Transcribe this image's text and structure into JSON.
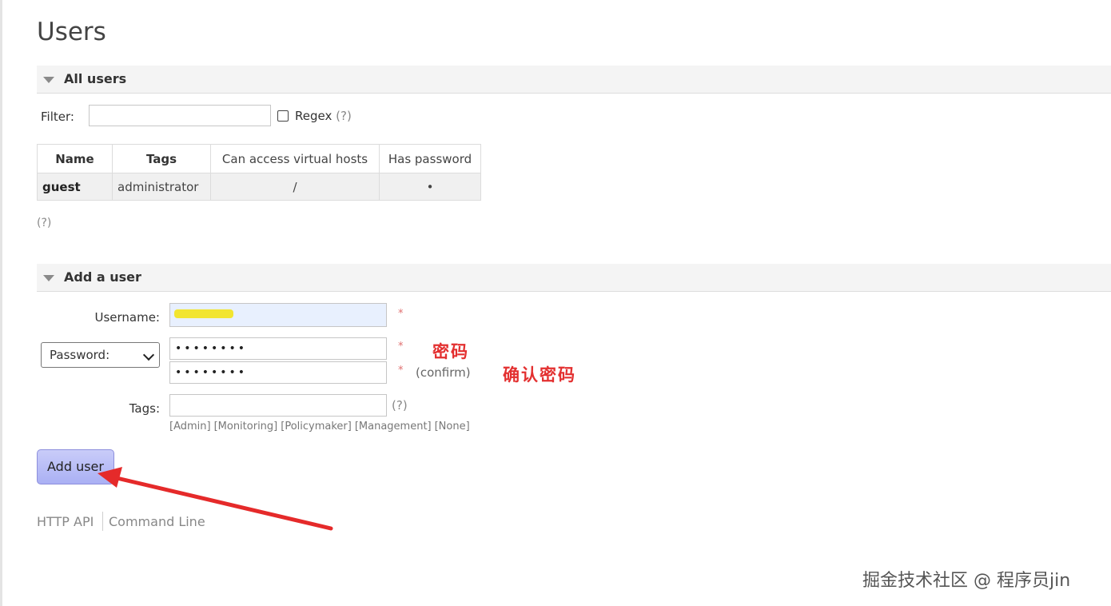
{
  "page": {
    "title": "Users"
  },
  "all_users": {
    "header": "All users",
    "filter_label": "Filter:",
    "filter_value": "",
    "regex_label": "Regex",
    "help": "(?)",
    "columns": [
      "Name",
      "Tags",
      "Can access virtual hosts",
      "Has password"
    ],
    "rows": [
      {
        "name": "guest",
        "tags": "administrator",
        "vhosts": "/",
        "has_password": "•"
      }
    ],
    "help_below": "(?)"
  },
  "add_user": {
    "header": "Add a user",
    "username_label": "Username:",
    "password_select": "Password:",
    "password_value": "••••••••",
    "confirm_value": "••••••••",
    "confirm_label": "(confirm)",
    "required_mark": "*",
    "tags_label": "Tags:",
    "tags_value": "",
    "tags_help": "(?)",
    "tag_options": [
      "[Admin]",
      "[Monitoring]",
      "[Policymaker]",
      "[Management]",
      "[None]"
    ],
    "submit": "Add user"
  },
  "annotations": {
    "password": "密码",
    "confirm": "确认密码"
  },
  "footer": {
    "http_api": "HTTP API",
    "command_line": "Command Line"
  },
  "watermark": "掘金技术社区 @ 程序员jin",
  "colors": {
    "button": "#aab0f4",
    "annotation": "#e33030",
    "required": "#e07070"
  }
}
